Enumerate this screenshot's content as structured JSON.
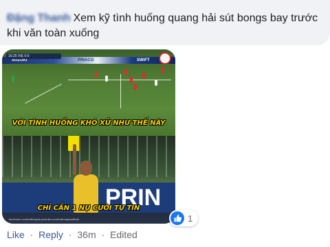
{
  "comment": {
    "author": "Đặng Thanh",
    "text": "Xem kỹ tình huống quang hải sút bongs bay trước khi văn toàn xuống"
  },
  "media": {
    "scoreboard": "16:25  VIE  0-0",
    "ad_left": "SUZUKI",
    "ad_mid": "PINACO",
    "ad_right": "SWIFT",
    "caption_top": "VỚI TÌNH HUỐNG KHÓ XỬ NHƯ THẾ NÀY",
    "caption_bottom": "CHỈ CẦN 1 NỤ CƯỜI TỰ TIN",
    "board_text": "PRIN",
    "watermark": "facebook.com/trollbongda   youtube.com/trollbongdaofficial"
  },
  "reaction": {
    "type": "like",
    "count": "1",
    "color": "#1877f2"
  },
  "actions": {
    "like": "Like",
    "reply": "Reply",
    "time": "36m",
    "edited": "Edited"
  }
}
